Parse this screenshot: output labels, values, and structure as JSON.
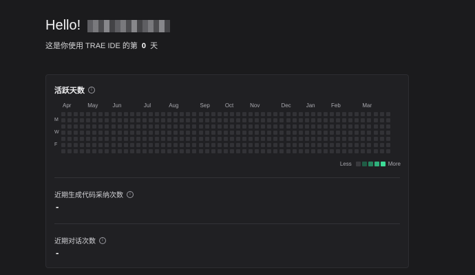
{
  "greeting": {
    "text": "Hello!"
  },
  "subtitle": {
    "prefix": "这是你使用 TRAE IDE 的第",
    "day": "0",
    "suffix": "天"
  },
  "activity": {
    "title": "活跃天数",
    "info_icon": "info-icon",
    "months": [
      "Apr",
      "May",
      "Jun",
      "Jul",
      "Aug",
      "Sep",
      "Oct",
      "Nov",
      "Dec",
      "Jan",
      "Feb",
      "Mar"
    ],
    "weekdays": [
      "M",
      "W",
      "F"
    ],
    "legend": {
      "less": "Less",
      "more": "More",
      "colors": [
        "#3a3a3e",
        "#1f5c45",
        "#26855f",
        "#2fb17c",
        "#3ddc97"
      ]
    },
    "empty_cell_color": "#323236"
  },
  "stats": [
    {
      "label": "近期生成代码采纳次数",
      "value": "-"
    },
    {
      "label": "近期对话次数",
      "value": "-"
    }
  ]
}
